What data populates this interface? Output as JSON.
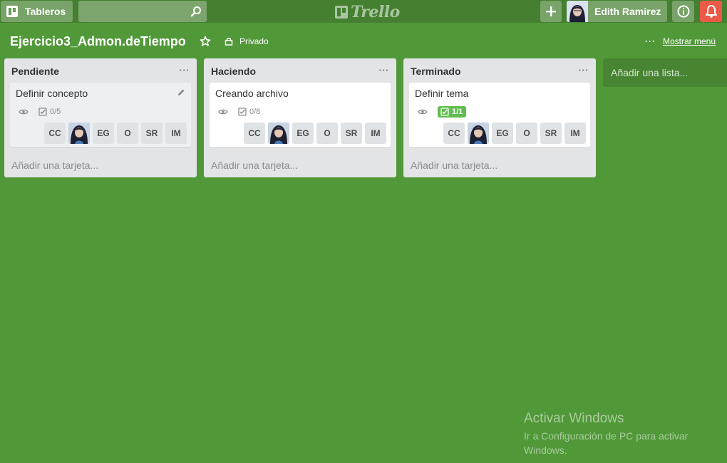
{
  "header": {
    "boards_label": "Tableros",
    "search_value": "",
    "logo_text": "Trello",
    "user_name": "Edith Ramirez"
  },
  "board": {
    "title": "Ejercicio3_Admon.deTiempo",
    "privacy_label": "Privado",
    "menu_label": "Mostrar menú",
    "menu_dots": "···"
  },
  "lists": [
    {
      "title": "Pendiente",
      "menu": "···",
      "card": {
        "title": "Definir concepto",
        "checklist": "0/5",
        "complete": false
      },
      "add_card": "Añadir una tarjeta..."
    },
    {
      "title": "Haciendo",
      "menu": "···",
      "card": {
        "title": "Creando archivo",
        "checklist": "0/8",
        "complete": false
      },
      "add_card": "Añadir una tarjeta..."
    },
    {
      "title": "Terminado",
      "menu": "···",
      "card": {
        "title": "Definir tema",
        "checklist": "1/1",
        "complete": true
      },
      "add_card": "Añadir una tarjeta..."
    }
  ],
  "members": [
    "CC",
    "EG",
    "O",
    "SR",
    "IM"
  ],
  "add_list_label": "Añadir una lista...",
  "watermark": {
    "title": "Activar Windows",
    "subtitle": "Ir a Configuración de PC para activar Windows."
  },
  "colors": {
    "board_background": "#519839",
    "header_background": "#448030",
    "notification_red": "#eb5a46",
    "checklist_complete_green": "#61bd4f"
  },
  "icons": [
    "boards-icon",
    "search-icon",
    "trello-logo-icon",
    "plus-icon",
    "info-icon",
    "bell-icon",
    "star-icon",
    "lock-icon",
    "eye-icon",
    "checklist-icon",
    "pencil-icon"
  ]
}
